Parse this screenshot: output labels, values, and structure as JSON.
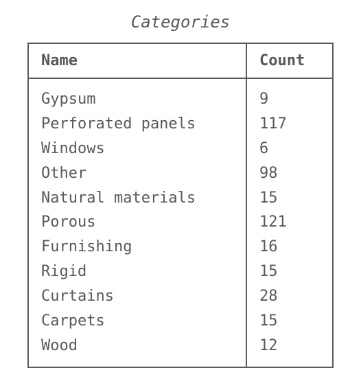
{
  "title": "Categories",
  "columns": [
    "Name",
    "Count"
  ],
  "rows": [
    {
      "name": "Gypsum",
      "count": 9
    },
    {
      "name": "Perforated panels",
      "count": 117
    },
    {
      "name": "Windows",
      "count": 6
    },
    {
      "name": "Other",
      "count": 98
    },
    {
      "name": "Natural materials",
      "count": 15
    },
    {
      "name": "Porous",
      "count": 121
    },
    {
      "name": "Furnishing",
      "count": 16
    },
    {
      "name": "Rigid",
      "count": 15
    },
    {
      "name": "Curtains",
      "count": 28
    },
    {
      "name": "Carpets",
      "count": 15
    },
    {
      "name": "Wood",
      "count": 12
    }
  ],
  "chart_data": {
    "type": "table",
    "title": "Categories",
    "columns": [
      "Name",
      "Count"
    ],
    "categories": [
      "Gypsum",
      "Perforated panels",
      "Windows",
      "Other",
      "Natural materials",
      "Porous",
      "Furnishing",
      "Rigid",
      "Curtains",
      "Carpets",
      "Wood"
    ],
    "values": [
      9,
      117,
      6,
      98,
      15,
      121,
      16,
      15,
      28,
      15,
      12
    ]
  }
}
